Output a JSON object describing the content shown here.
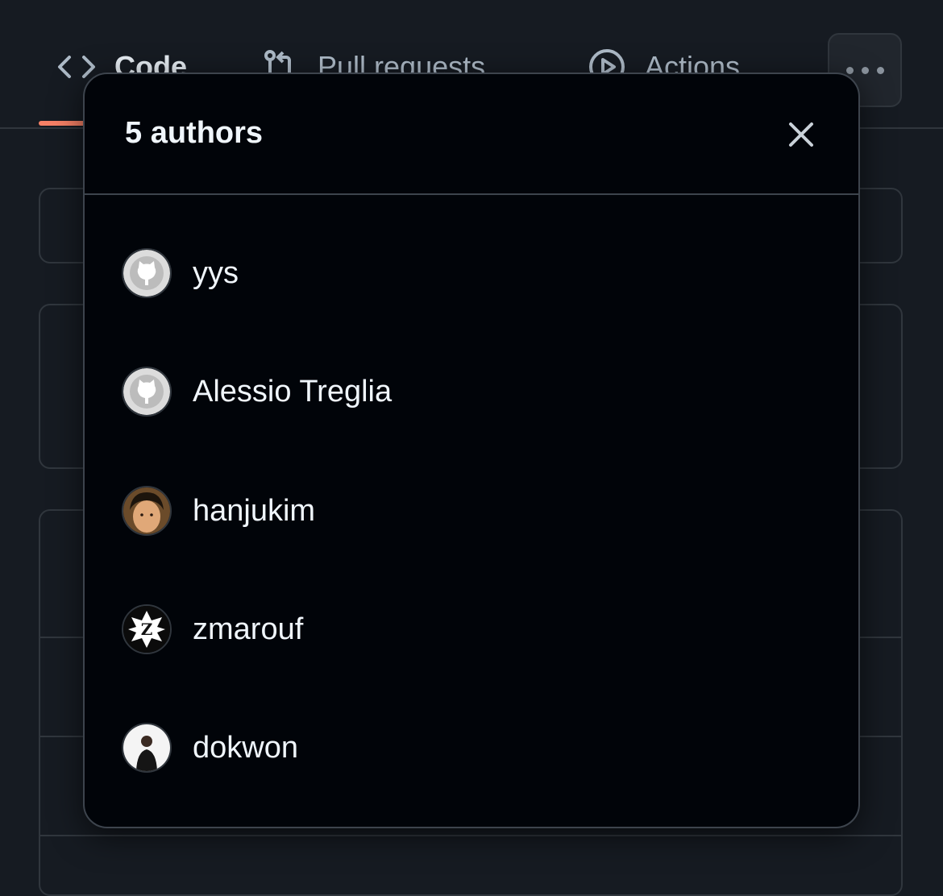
{
  "nav": {
    "tabs": [
      {
        "label": "Code",
        "icon": "code-icon"
      },
      {
        "label": "Pull requests",
        "icon": "pull-request-icon"
      },
      {
        "label": "Actions",
        "icon": "play-icon"
      }
    ],
    "more_icon": "kebab-horizontal-icon"
  },
  "dialog": {
    "title": "5 authors",
    "close_icon": "x-icon",
    "authors": [
      {
        "name": "yys",
        "avatar": "github-default-avatar"
      },
      {
        "name": "Alessio Treglia",
        "avatar": "github-default-avatar"
      },
      {
        "name": "hanjukim",
        "avatar": "photo-avatar"
      },
      {
        "name": "zmarouf",
        "avatar": "emblem-avatar"
      },
      {
        "name": "dokwon",
        "avatar": "photo-avatar"
      }
    ]
  },
  "colors": {
    "page_bg": "#161b22",
    "dialog_bg": "#010409",
    "border": "#3d444d",
    "active_tab_underline": "#f78166",
    "text": "#f0f6fc"
  }
}
